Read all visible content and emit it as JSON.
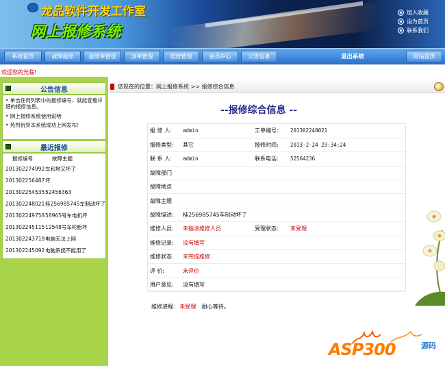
{
  "header": {
    "company": "龙品软件开发工作室",
    "system_title": "网上报修系统",
    "quicklinks": [
      "加入收藏",
      "设为首页",
      "联系我们"
    ]
  },
  "nav": {
    "items": [
      "系统首页",
      "故障报修",
      "报修单管理",
      "派单管理",
      "维修管理",
      "会员中心",
      "公告信息"
    ],
    "logout": "退出系统",
    "site_home": "网站首页"
  },
  "welcome": "欢迎您的光临!",
  "sidebar": {
    "notice_title": "公告信息",
    "notices": [
      "• 单击任何列表中的报修编号，就能查看详细的报修信息。",
      "• 网上报修系统使用说明",
      "• 热烈祝贺本系统成功上网发布!"
    ],
    "recent_title": "最近报修",
    "recent_headers": [
      "报修编号",
      "故障主题"
    ],
    "recent": [
      {
        "code": "201302274992",
        "subject": "车和地又坏了"
      },
      {
        "code": "201302256487",
        "subject": "坏"
      },
      {
        "code": "201302254535",
        "subject": "52456363"
      },
      {
        "code": "201302248021",
        "subject": "桂256985745车制动坏了"
      },
      {
        "code": "201302249758",
        "subject": "58965号车电机坏"
      },
      {
        "code": "201302245115",
        "subject": "12548号车轮胎坏"
      },
      {
        "code": "201302243719",
        "subject": "电脑无法上网"
      },
      {
        "code": "201302245092",
        "subject": "电脑系统不能用了"
      }
    ]
  },
  "breadcrumb": "您现在的位置：网上报修系统 >> 报修综合信息",
  "page_heading": "--报修综合信息 --",
  "detail": {
    "reporter_label": "报 修 人:",
    "reporter": "admin",
    "ticket_no_label": "工单编号:",
    "ticket_no": "201302248021",
    "type_label": "报修类型:",
    "type": "其它",
    "time_label": "报修时间:",
    "time": "2013-2-24 23:34:24",
    "contact_label": "联 系 人:",
    "contact": "admin",
    "phone_label": "联系电话:",
    "phone": "52564236",
    "dept_label": "故障部门",
    "location_label": "故障地点",
    "subject_label": "故障主题",
    "desc_label": "故障描述:",
    "desc": "桂256985745车制动坏了",
    "tech_label": "维修人员:",
    "tech": "未指派维修人员",
    "accept_label": "受理状态:",
    "accept": "未受理",
    "record_label": "维修记录:",
    "record": "没有填写",
    "repair_status_label": "维修状态:",
    "repair_status": "未完成维修",
    "rating_label": "评    价:",
    "rating": "未评价",
    "opinion_label": "用户意见:",
    "opinion": "没有填写"
  },
  "progress": {
    "label": "维修进程:",
    "status": "未受理",
    "note": "耐心等待。"
  },
  "watermark": {
    "main": "ASP300",
    "sub": "源码"
  },
  "colors": {
    "nav_bg": "#2c73cf",
    "sidebar_bg": "#a9d44a",
    "status_red": "#c00000",
    "heading_blue": "#2a2a8e"
  }
}
